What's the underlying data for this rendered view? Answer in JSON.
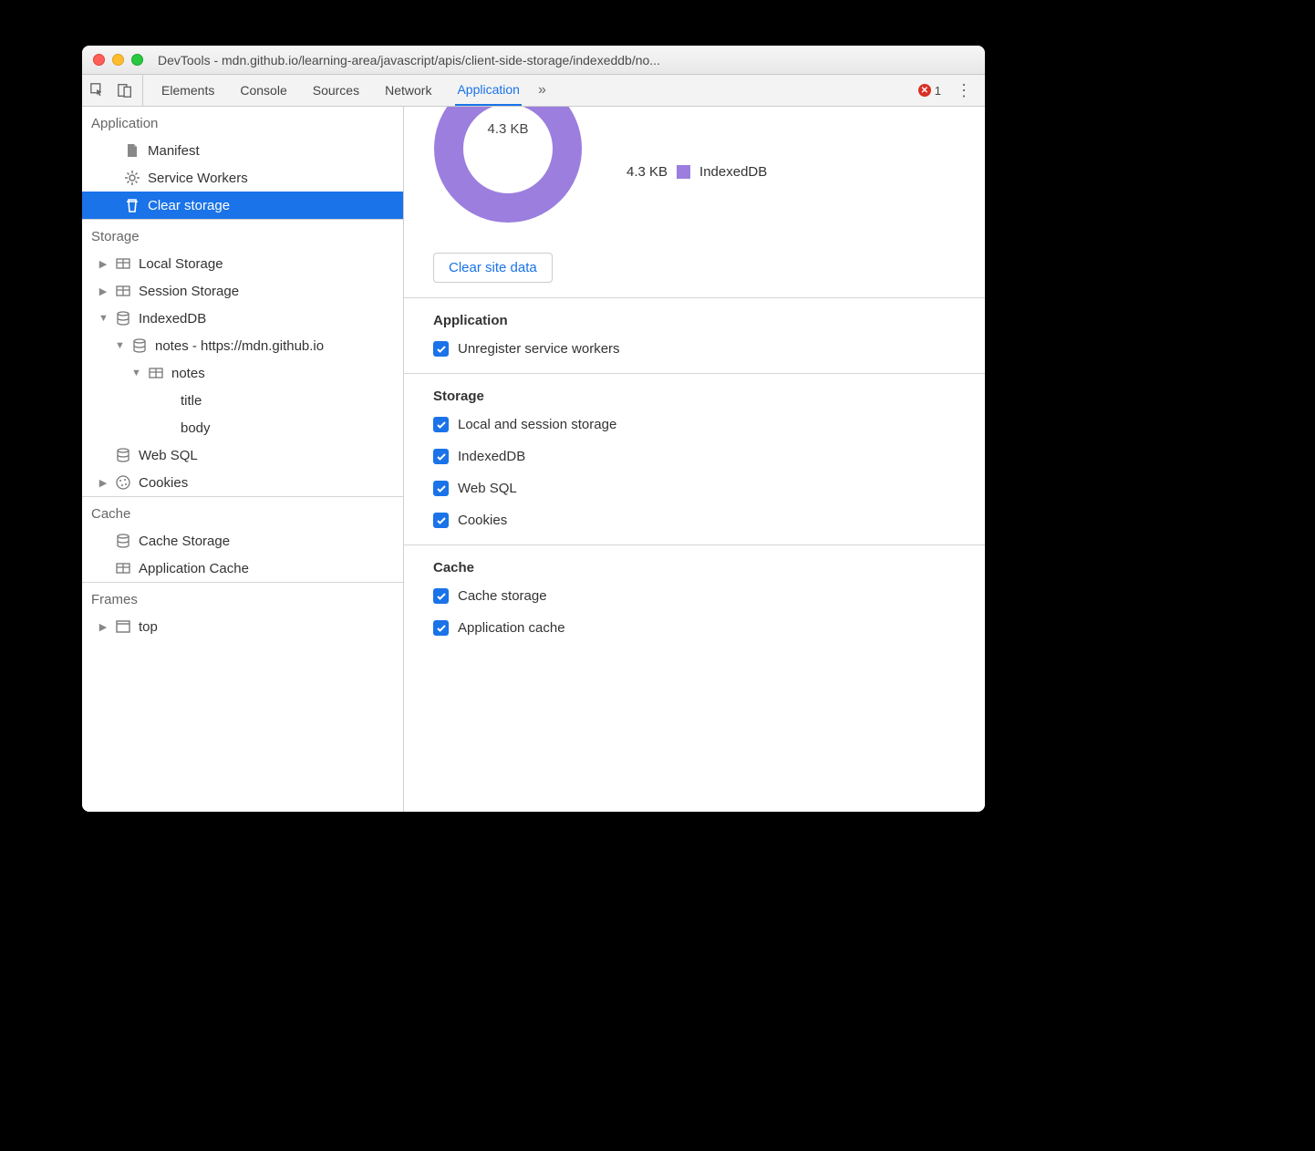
{
  "window": {
    "title": "DevTools - mdn.github.io/learning-area/javascript/apis/client-side-storage/indexeddb/no..."
  },
  "tabs": {
    "elements": "Elements",
    "console": "Console",
    "sources": "Sources",
    "network": "Network",
    "application": "Application"
  },
  "errors": {
    "count": "1"
  },
  "sidebar": {
    "application": {
      "header": "Application",
      "manifest": "Manifest",
      "service_workers": "Service Workers",
      "clear_storage": "Clear storage"
    },
    "storage": {
      "header": "Storage",
      "local_storage": "Local Storage",
      "session_storage": "Session Storage",
      "indexeddb": "IndexedDB",
      "db_notes": "notes - https://mdn.github.io",
      "table_notes": "notes",
      "col_title": "title",
      "col_body": "body",
      "websql": "Web SQL",
      "cookies": "Cookies"
    },
    "cache": {
      "header": "Cache",
      "cache_storage": "Cache Storage",
      "app_cache": "Application Cache"
    },
    "frames": {
      "header": "Frames",
      "top": "top"
    }
  },
  "usage": {
    "total": "4.3 KB",
    "legend_value": "4.3 KB",
    "legend_label": "IndexedDB"
  },
  "clear_button": "Clear site data",
  "groups": {
    "application": {
      "header": "Application",
      "unregister": "Unregister service workers"
    },
    "storage": {
      "header": "Storage",
      "local_session": "Local and session storage",
      "indexeddb": "IndexedDB",
      "websql": "Web SQL",
      "cookies": "Cookies"
    },
    "cache": {
      "header": "Cache",
      "cache_storage": "Cache storage",
      "app_cache": "Application cache"
    }
  },
  "colors": {
    "accent": "#1a73e8",
    "donut": "#9b7ede"
  }
}
